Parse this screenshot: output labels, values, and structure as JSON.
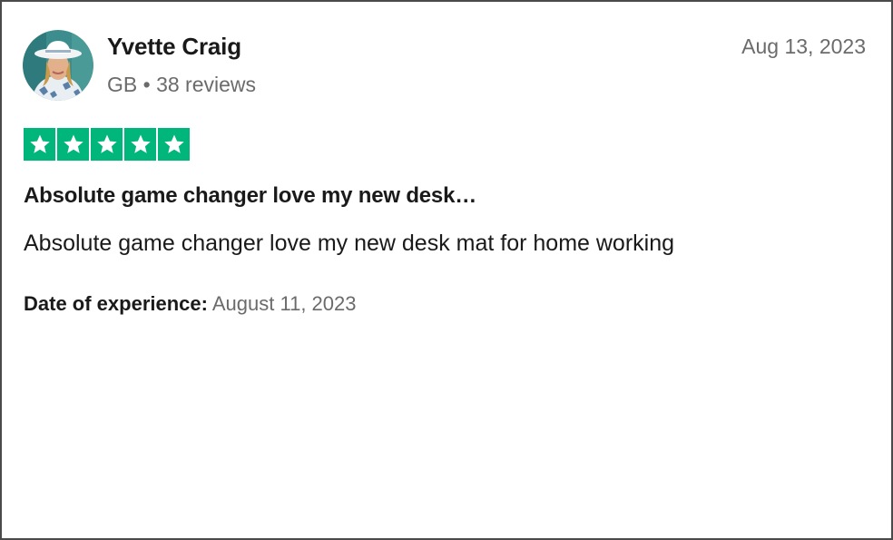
{
  "reviewer": {
    "name": "Yvette Craig",
    "country": "GB",
    "separator": "•",
    "reviews_count": "38 reviews",
    "avatar_icon": "user-photo-avatar"
  },
  "review": {
    "posted_date": "Aug 13, 2023",
    "rating": 5,
    "rating_max": 5,
    "star_color": "#00b67a",
    "title": "Absolute game changer love my new desk…",
    "body": "Absolute game changer love my new desk mat for home working",
    "experience_label": "Date of experience:",
    "experience_date": "August 11, 2023"
  }
}
